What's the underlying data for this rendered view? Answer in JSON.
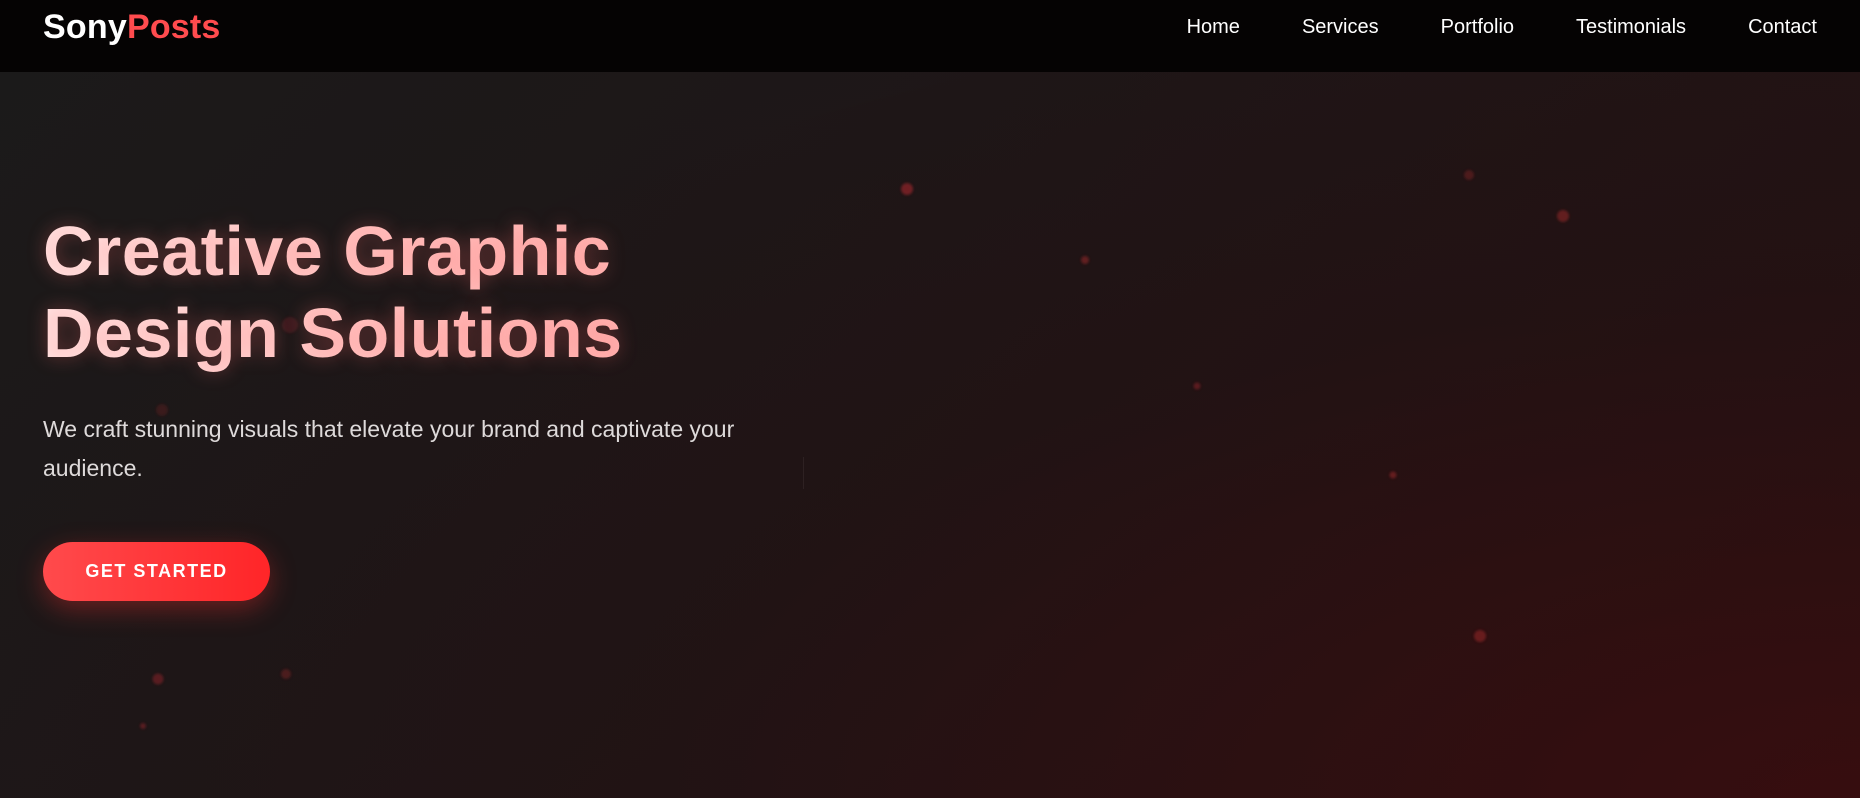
{
  "navbar": {
    "logo_part1": "Sony",
    "logo_part2": "Posts",
    "links": [
      {
        "label": "Home"
      },
      {
        "label": "Services"
      },
      {
        "label": "Portfolio"
      },
      {
        "label": "Testimonials"
      },
      {
        "label": "Contact"
      }
    ]
  },
  "hero": {
    "title_line1": "Creative Graphic",
    "title_line2": "Design Solutions",
    "subtitle": "We craft stunning visuals that elevate your brand and captivate your audience.",
    "cta_label": "GET STARTED"
  },
  "colors": {
    "accent": "#ff4b4e",
    "nav_background": "#050303",
    "hero_title": "#ffc1bf"
  }
}
